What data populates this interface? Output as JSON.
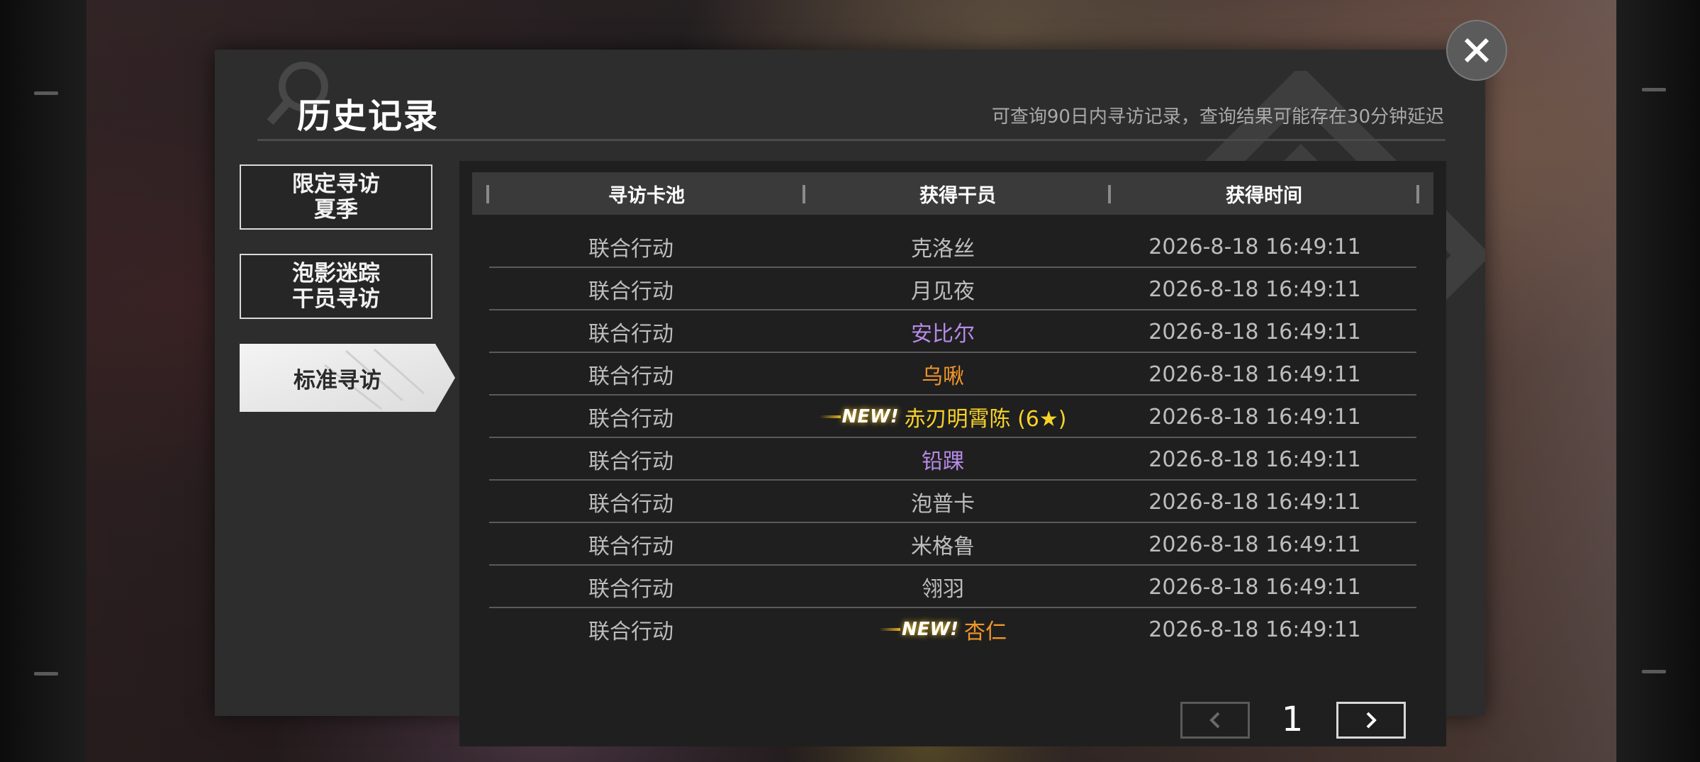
{
  "dialog": {
    "title": "历史记录",
    "note": "可查询90日内寻访记录，查询结果可能存在30分钟延迟"
  },
  "nav": {
    "items": [
      {
        "line1": "限定寻访",
        "line2": "夏季"
      },
      {
        "line1": "泡影迷踪",
        "line2": "干员寻访"
      },
      {
        "line1": "标准寻访",
        "active": true
      }
    ]
  },
  "table": {
    "headers": [
      "寻访卡池",
      "获得干员",
      "获得时间"
    ],
    "rows": [
      {
        "pool": "联合行动",
        "operator": "克洛丝",
        "time": "2026-8-18 16:49:11",
        "color": "#bdbdbd",
        "new": false
      },
      {
        "pool": "联合行动",
        "operator": "月见夜",
        "time": "2026-8-18 16:49:11",
        "color": "#bdbdbd",
        "new": false
      },
      {
        "pool": "联合行动",
        "operator": "安比尔",
        "time": "2026-8-18 16:49:11",
        "color": "#b68ae6",
        "new": false
      },
      {
        "pool": "联合行动",
        "operator": "乌啾",
        "time": "2026-8-18 16:49:11",
        "color": "#f0962a",
        "new": false
      },
      {
        "pool": "联合行动",
        "operator": "赤刃明霄陈 (6★)",
        "time": "2026-8-18 16:49:11",
        "color": "#f7d22a",
        "new": true
      },
      {
        "pool": "联合行动",
        "operator": "铅踝",
        "time": "2026-8-18 16:49:11",
        "color": "#b68ae6",
        "new": false
      },
      {
        "pool": "联合行动",
        "operator": "泡普卡",
        "time": "2026-8-18 16:49:11",
        "color": "#bdbdbd",
        "new": false
      },
      {
        "pool": "联合行动",
        "operator": "米格鲁",
        "time": "2026-8-18 16:49:11",
        "color": "#bdbdbd",
        "new": false
      },
      {
        "pool": "联合行动",
        "operator": "翎羽",
        "time": "2026-8-18 16:49:11",
        "color": "#bdbdbd",
        "new": false
      },
      {
        "pool": "联合行动",
        "operator": "杏仁",
        "time": "2026-8-18 16:49:11",
        "color": "#f0962a",
        "new": true
      }
    ],
    "new_label": "NEW!"
  },
  "pager": {
    "page": "1",
    "prev_icon": "chevron-left-icon",
    "next_icon": "chevron-right-icon"
  },
  "close_icon": "close-icon"
}
